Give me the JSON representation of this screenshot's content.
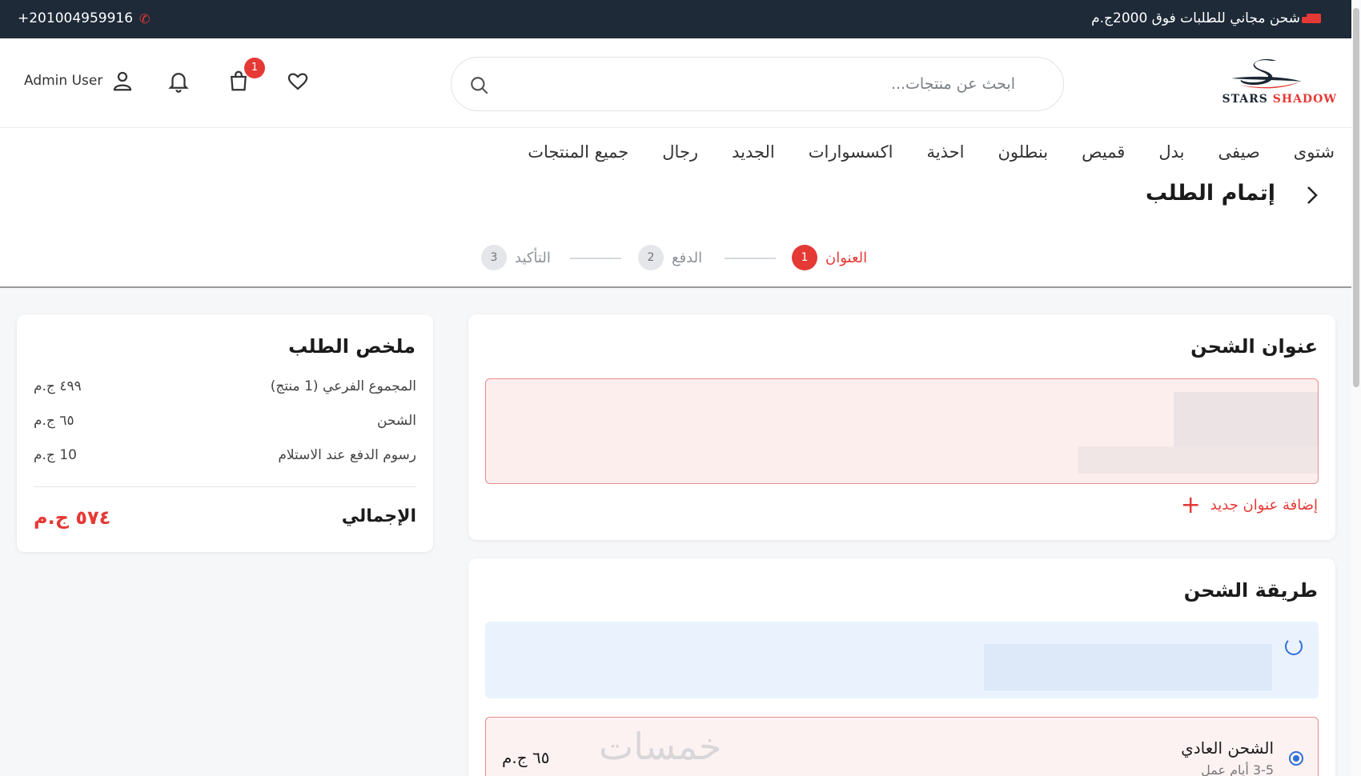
{
  "topbar": {
    "promo": "شحن مجاني للطلبات فوق 2000ج.م",
    "phone": "+201004959916"
  },
  "header": {
    "logo_text_primary": "STARS",
    "logo_text_secondary": "SHADOW",
    "search_placeholder": "ابحث عن منتجات...",
    "user_name": "Admin User",
    "cart_count": "1"
  },
  "nav": {
    "items": [
      "شتوى",
      "صيفى",
      "بدل",
      "قميص",
      "بنطلون",
      "احذية",
      "اكسسوارات",
      "الجديد",
      "رجال",
      "جميع المنتجات"
    ]
  },
  "checkout": {
    "title": "إتمام الطلب",
    "steps": [
      {
        "num": "1",
        "label": "العنوان"
      },
      {
        "num": "2",
        "label": "الدفع"
      },
      {
        "num": "3",
        "label": "التأكيد"
      }
    ]
  },
  "shipping_address": {
    "title": "عنوان الشحن",
    "add_label": "إضافة عنوان جديد"
  },
  "shipping_method": {
    "title": "طريقة الشحن",
    "option_name": "الشحن العادي",
    "option_sub": "3-5 أيام عمل",
    "option_price": "٦٥ ج.م"
  },
  "summary": {
    "title": "ملخص الطلب",
    "rows": [
      {
        "label": "المجموع الفرعي (1 منتج)",
        "value": "٤٩٩ ج.م"
      },
      {
        "label": "الشحن",
        "value": "٦٥ ج.م"
      },
      {
        "label": "رسوم الدفع عند الاستلام",
        "value": "10 ج.م"
      }
    ],
    "total_label": "الإجمالي",
    "total_value": "٥٧٤ ج.م"
  },
  "watermark": "خمسات",
  "colors": {
    "brand_red": "#e53935",
    "topbar_bg": "#1e2a38",
    "accent_blue": "#2f6fd6"
  }
}
